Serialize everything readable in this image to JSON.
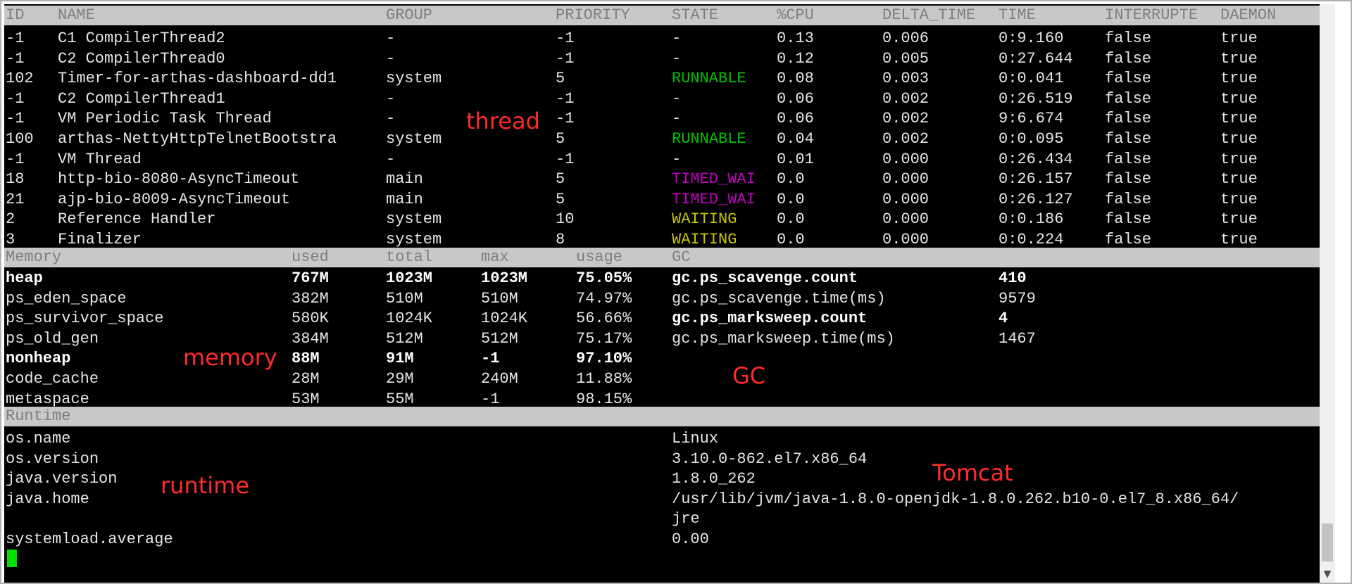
{
  "thread": {
    "headers": [
      "ID",
      "NAME",
      "GROUP",
      "PRIORITY",
      "STATE",
      "%CPU",
      "DELTA_TIME",
      "TIME",
      "INTERRUPTE",
      "DAEMON"
    ],
    "rows": [
      [
        "-1",
        "C1 CompilerThread2",
        "-",
        "-1",
        "-",
        "0.13",
        "0.006",
        "0:9.160",
        "false",
        "true"
      ],
      [
        "-1",
        "C2 CompilerThread0",
        "-",
        "-1",
        "-",
        "0.12",
        "0.005",
        "0:27.644",
        "false",
        "true"
      ],
      [
        "102",
        "Timer-for-arthas-dashboard-dd1",
        "system",
        "5",
        "RUNNABLE",
        "0.08",
        "0.003",
        "0:0.041",
        "false",
        "true"
      ],
      [
        "-1",
        "C2 CompilerThread1",
        "-",
        "-1",
        "-",
        "0.06",
        "0.002",
        "0:26.519",
        "false",
        "true"
      ],
      [
        "-1",
        "VM Periodic Task Thread",
        "-",
        "-1",
        "-",
        "0.06",
        "0.002",
        "9:6.674",
        "false",
        "true"
      ],
      [
        "100",
        "arthas-NettyHttpTelnetBootstra",
        "system",
        "5",
        "RUNNABLE",
        "0.04",
        "0.002",
        "0:0.095",
        "false",
        "true"
      ],
      [
        "-1",
        "VM Thread",
        "-",
        "-1",
        "-",
        "0.01",
        "0.000",
        "0:26.434",
        "false",
        "true"
      ],
      [
        "18",
        "http-bio-8080-AsyncTimeout",
        "main",
        "5",
        "TIMED_WAI",
        "0.0",
        "0.000",
        "0:26.157",
        "false",
        "true"
      ],
      [
        "21",
        "ajp-bio-8009-AsyncTimeout",
        "main",
        "5",
        "TIMED_WAI",
        "0.0",
        "0.000",
        "0:26.127",
        "false",
        "true"
      ],
      [
        "2",
        "Reference Handler",
        "system",
        "10",
        "WAITING",
        "0.0",
        "0.000",
        "0:0.186",
        "false",
        "true"
      ],
      [
        "3",
        "Finalizer",
        "system",
        "8",
        "WAITING",
        "0.0",
        "0.000",
        "0:0.224",
        "false",
        "true"
      ]
    ]
  },
  "memory": {
    "headers": [
      "Memory",
      "used",
      "total",
      "max",
      "usage",
      "GC"
    ],
    "rows": [
      [
        "heap",
        "767M",
        "1023M",
        "1023M",
        "75.05%"
      ],
      [
        "ps_eden_space",
        "382M",
        "510M",
        "510M",
        "74.97%"
      ],
      [
        "ps_survivor_space",
        "580K",
        "1024K",
        "1024K",
        "56.66%"
      ],
      [
        "ps_old_gen",
        "384M",
        "512M",
        "512M",
        "75.17%"
      ],
      [
        "nonheap",
        "88M",
        "91M",
        "-1",
        "97.10%"
      ],
      [
        "code_cache",
        "28M",
        "29M",
        "240M",
        "11.88%"
      ],
      [
        "metaspace",
        "53M",
        "55M",
        "-1",
        "98.15%"
      ]
    ],
    "gc": [
      [
        "gc.ps_scavenge.count",
        "410"
      ],
      [
        "gc.ps_scavenge.time(ms)",
        "9579"
      ],
      [
        "gc.ps_marksweep.count",
        "4"
      ],
      [
        "gc.ps_marksweep.time(ms)",
        "1467"
      ]
    ]
  },
  "runtime": {
    "header": "Runtime",
    "rows": [
      [
        "os.name",
        "Linux"
      ],
      [
        "os.version",
        "3.10.0-862.el7.x86_64"
      ],
      [
        "java.version",
        "1.8.0_262"
      ],
      [
        "java.home",
        "/usr/lib/jvm/java-1.8.0-openjdk-1.8.0.262.b10-0.el7_8.x86_64/"
      ],
      [
        "",
        "jre"
      ],
      [
        "systemload.average",
        "0.00"
      ]
    ]
  },
  "annotations": {
    "thread": "thread",
    "memory": "memory",
    "gc": "GC",
    "runtime": "runtime",
    "tomcat": "Tomcat"
  },
  "colors": {
    "background": "#000000",
    "text": "#e6e6e6",
    "header_bar": "#c8c8c8",
    "header_text": "#7f7f7f",
    "runnable": "#00c000",
    "timed_waiting": "#c000c0",
    "waiting": "#c8c800",
    "annotation": "#ff2b2b",
    "cursor": "#00e000"
  },
  "scrollbar": {
    "down_arrow": "chevron-down-icon"
  }
}
